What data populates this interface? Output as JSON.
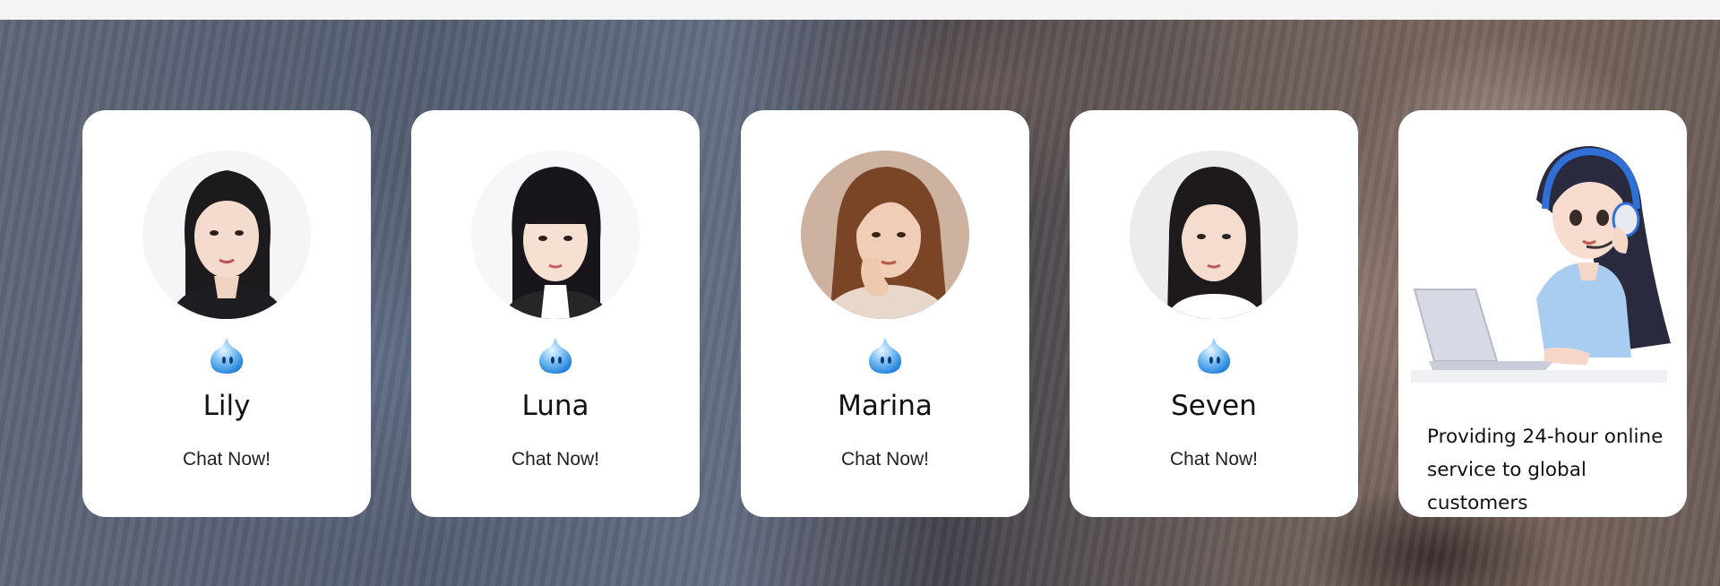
{
  "agents": [
    {
      "name": "Lily",
      "cta": "Chat Now!",
      "icon": "chat-bubble-icon",
      "photo": "photo-of-lily"
    },
    {
      "name": "Luna",
      "cta": "Chat Now!",
      "icon": "chat-bubble-icon",
      "photo": "photo-of-luna"
    },
    {
      "name": "Marina",
      "cta": "Chat Now!",
      "icon": "chat-bubble-icon",
      "photo": "photo-of-marina"
    },
    {
      "name": "Seven",
      "cta": "Chat Now!",
      "icon": "chat-bubble-icon",
      "photo": "photo-of-seven"
    }
  ],
  "promo": {
    "text": "Providing 24-hour online service to global customers",
    "illustration": "support-agent-with-headset-and-laptop"
  },
  "colors": {
    "card_bg": "#ffffff",
    "icon_blue": "#2f8be0",
    "text": "#111111"
  }
}
